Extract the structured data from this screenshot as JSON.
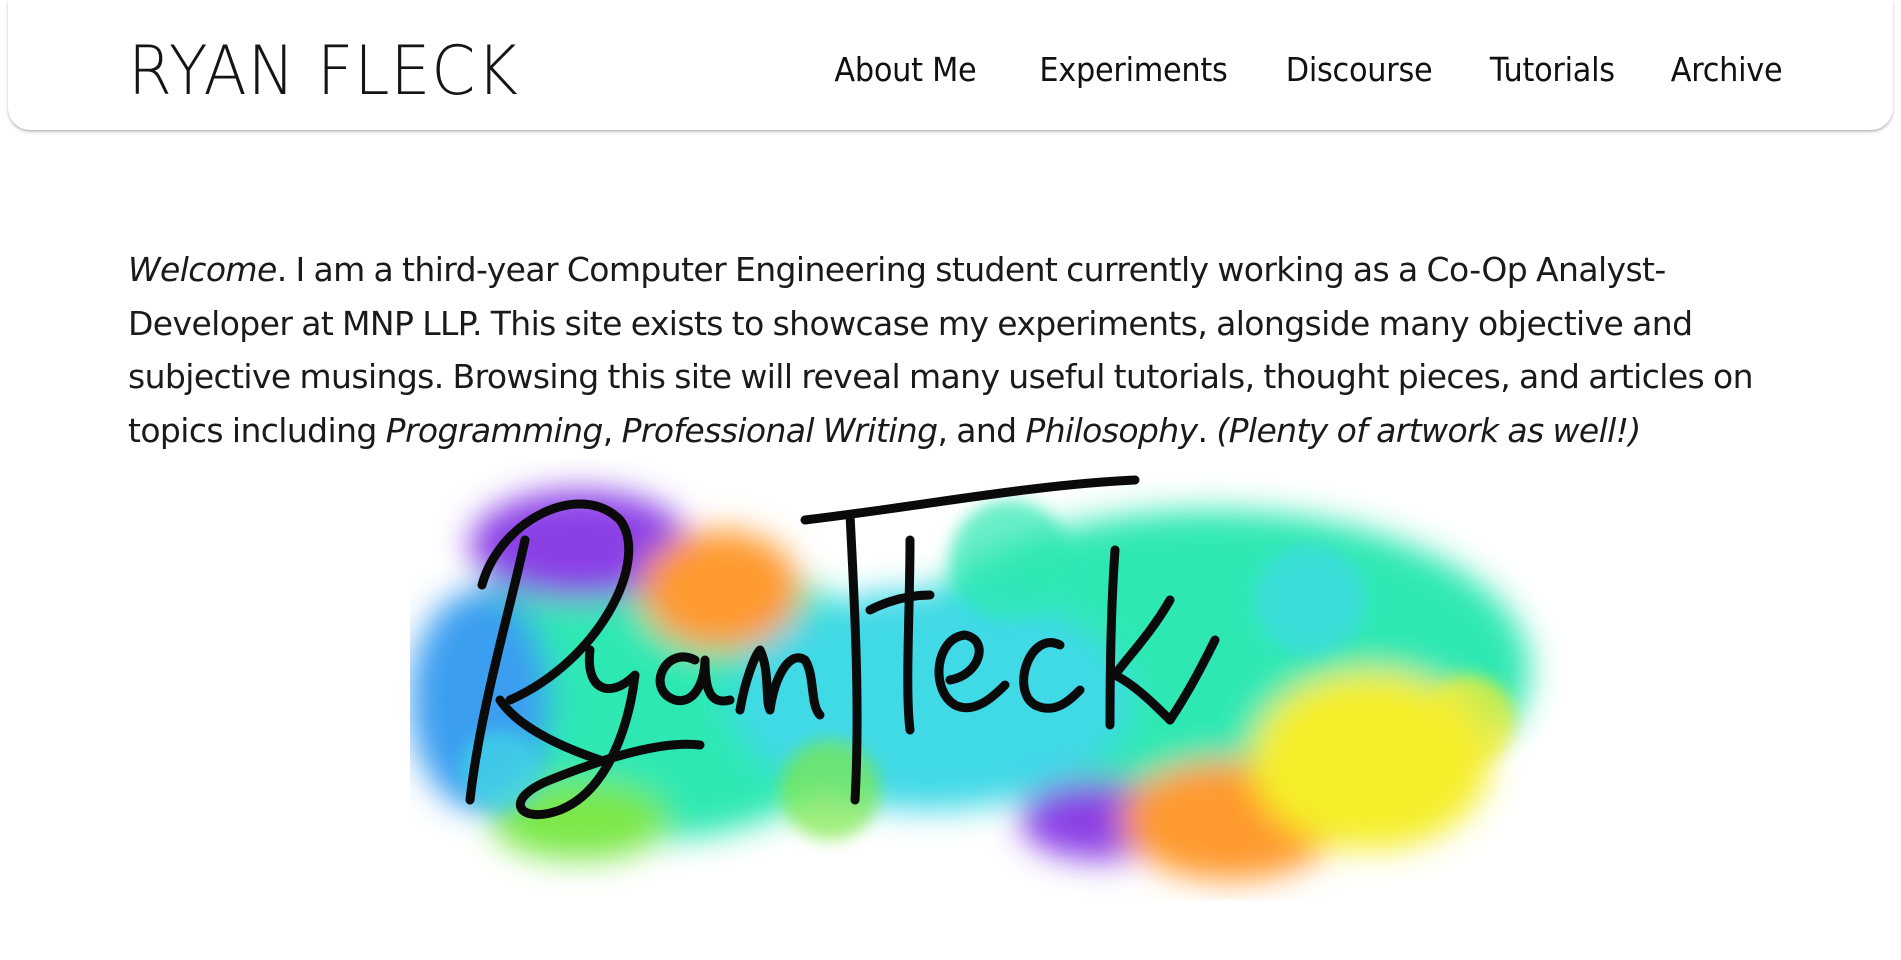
{
  "header": {
    "site_title": "RYAN FLECK",
    "nav": [
      {
        "label": "About Me"
      },
      {
        "label": "Experiments"
      },
      {
        "label": "Discourse"
      },
      {
        "label": "Tutorials"
      },
      {
        "label": "Archive"
      }
    ]
  },
  "intro": {
    "welcome": "Welcome",
    "part1": ". I am a third-year Computer Engineering student currently working as a Co-Op Analyst-Developer at MNP LLP. This site exists to showcase my experiments, alongside many objective and subjective musings. Browsing this site will reveal many useful tutorials, thought pieces, and articles on topics including ",
    "topic1": "Programming",
    "sep1": ", ",
    "topic2": "Professional Writing",
    "sep2": ", and ",
    "topic3": "Philosophy",
    "sep3": ". ",
    "aside": "(Plenty of artwork as well!)"
  },
  "hero": {
    "signature_text": "Ryan Fleck",
    "colors": {
      "teal": "#2ee8b4",
      "cyan": "#3fd9e6",
      "blue": "#3b9ef0",
      "purple": "#8b3fe6",
      "orange": "#ff9a2e",
      "yellow": "#f5ee2a",
      "green": "#7be84a",
      "ink": "#0a0a0a"
    }
  }
}
